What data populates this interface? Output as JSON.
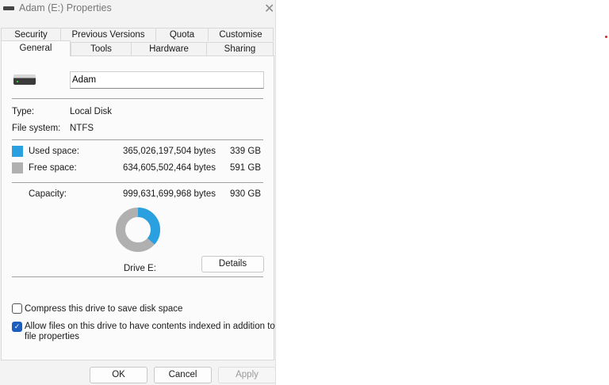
{
  "window": {
    "title": "Adam (E:) Properties",
    "close": "✕"
  },
  "tabs_row1": [
    "Security",
    "Previous Versions",
    "Quota",
    "Customise"
  ],
  "tabs_row2": [
    "General",
    "Tools",
    "Hardware",
    "Sharing"
  ],
  "drive_name": "Adam",
  "type": {
    "label": "Type:",
    "value": "Local Disk"
  },
  "filesystem": {
    "label": "File system:",
    "value": "NTFS"
  },
  "used": {
    "label": "Used space:",
    "bytes": "365,026,197,504 bytes",
    "size": "339 GB",
    "color": "#2aa0e0",
    "fraction": 0.365
  },
  "free": {
    "label": "Free space:",
    "bytes": "634,605,502,464 bytes",
    "size": "591 GB",
    "color": "#b0b0b0"
  },
  "capacity": {
    "label": "Capacity:",
    "bytes": "999,631,699,968 bytes",
    "size": "930 GB"
  },
  "drive_label": "Drive E:",
  "details_button": "Details",
  "compress": {
    "label": "Compress this drive to save disk space",
    "checked": false
  },
  "index": {
    "label1": "Allow files on this drive to have contents indexed in addition to",
    "label2": "file properties",
    "checked": true
  },
  "buttons": {
    "ok": "OK",
    "cancel": "Cancel",
    "apply": "Apply"
  }
}
